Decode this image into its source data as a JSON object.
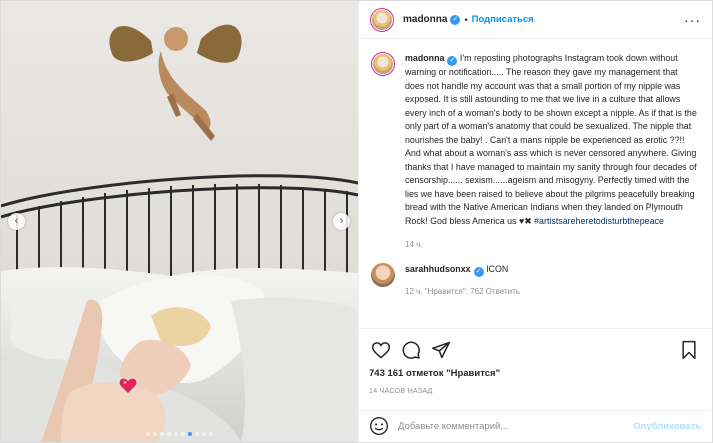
{
  "photo": {
    "nav_prev": "‹",
    "nav_next": "›",
    "slides_total": 10,
    "slide_active_index": 6
  },
  "header": {
    "username": "madonna",
    "separator": "•",
    "follow_label": "Подписаться",
    "more_label": "···"
  },
  "caption": {
    "username": "madonna",
    "text": "I'm reposting photographs Instagram took down without warning or notification..... The reason they gave my management that does not handle my account was that a small portion of my nipple was exposed. It is still astounding to me that we live in a culture that allows every inch of a woman's body to be shown except a nipple. As if that is the only part of a woman's anatomy that could be sexualized. The nipple that nourishes the baby! . Can't a mans nipple be experienced as erotic ??!! And what about a woman's ass which is never censored anywhere. Giving thanks that I have managed to maintain my sanity through four decades of censorship...... sexism......ageism and misogyny. Perfectly timed with the lies we have been raised to believe about the pilgrims peacefully breaking bread with the Native American Indians when they landed on Plymouth Rock! God bless America us ♥✖ ",
    "hashtag": "#artistsareheretodisturbthepeace",
    "time_ago": "14 ч."
  },
  "comment": {
    "username": "sarahhudsonxx",
    "text": "ICON",
    "meta": "12 ч.   \"Нравится\": 762   Ответить"
  },
  "actions": {
    "likes": "743 161 отметок \"Нравится\"",
    "date": "14 ЧАСОВ НАЗАД"
  },
  "add_comment": {
    "placeholder": "Добавьте комментарий...",
    "publish_label": "Опубликовать"
  },
  "colors": {
    "accent": "#0095f6",
    "verified": "#3897f0",
    "publish_disabled": "#b2dffc"
  }
}
